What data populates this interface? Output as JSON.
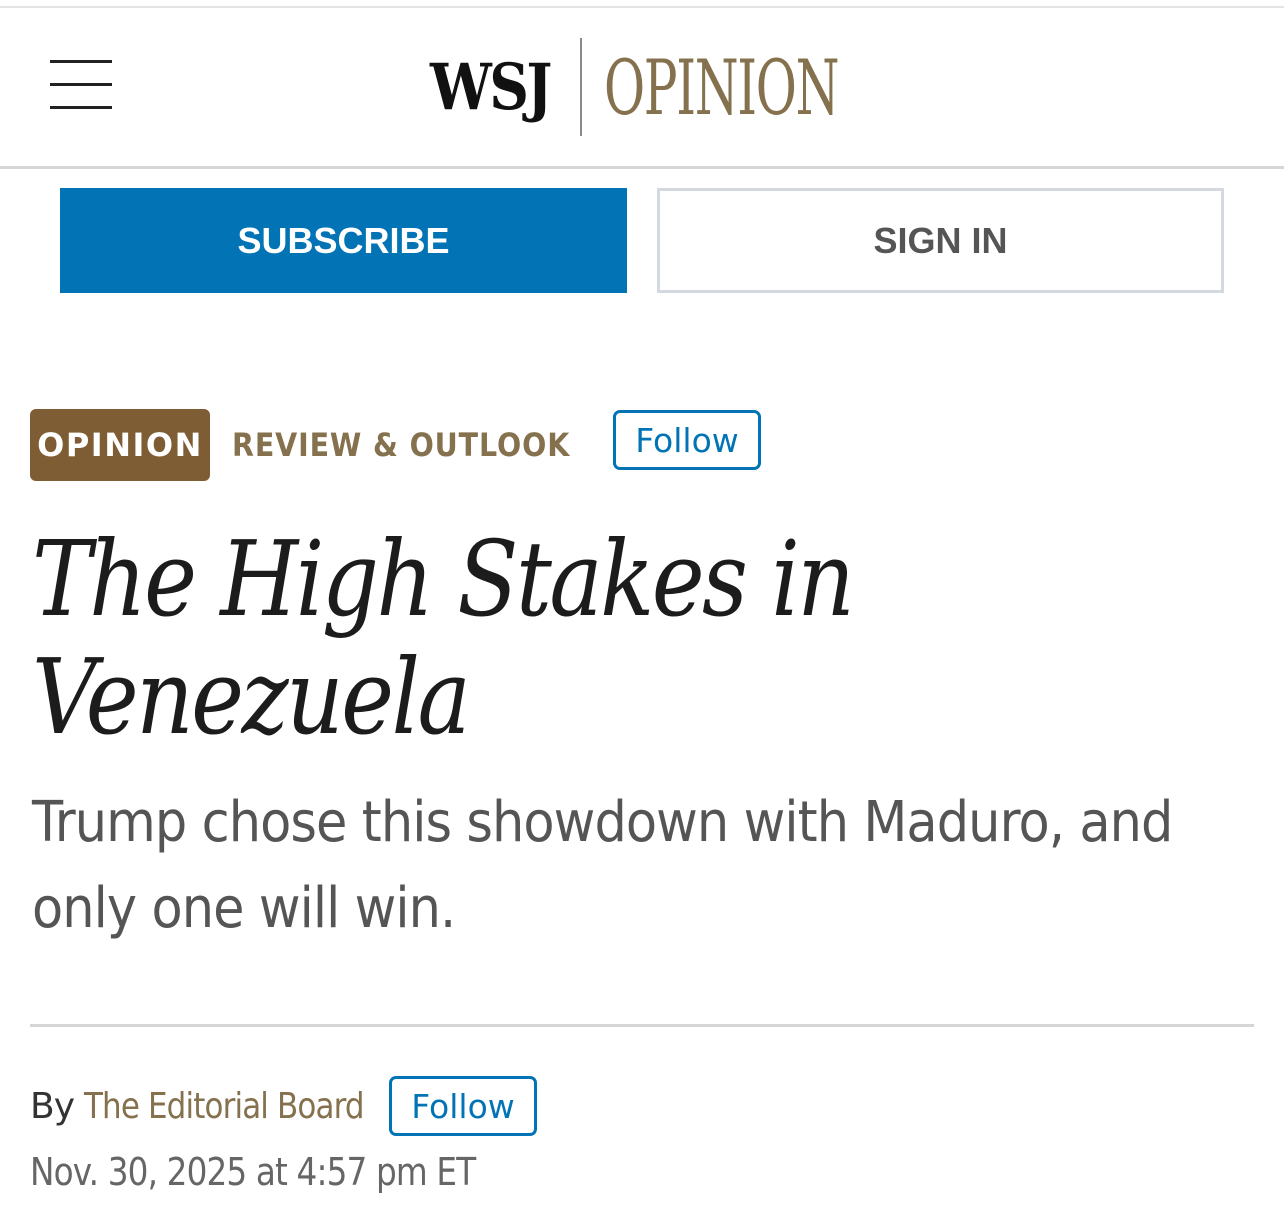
{
  "header": {
    "logo_wsj": "WSJ",
    "logo_section": "OPINION"
  },
  "account": {
    "subscribe_label": "SUBSCRIBE",
    "signin_label": "SIGN IN"
  },
  "article": {
    "category_badge": "OPINION",
    "section": "REVIEW & OUTLOOK",
    "section_follow_label": "Follow",
    "headline_lines": [
      "The High Stakes in",
      "Venezuela"
    ],
    "dek_lines": [
      "Trump chose this showdown with Maduro, and",
      "only one will win."
    ],
    "byline_prefix": "By",
    "author": "The Editorial Board",
    "author_follow_label": "Follow",
    "timestamp": "Nov. 30, 2025 at 4:57 pm ET"
  },
  "colors": {
    "accent_blue": "#0274b6",
    "opinion_gold": "#85714d",
    "badge_brown": "#7f5d34"
  }
}
